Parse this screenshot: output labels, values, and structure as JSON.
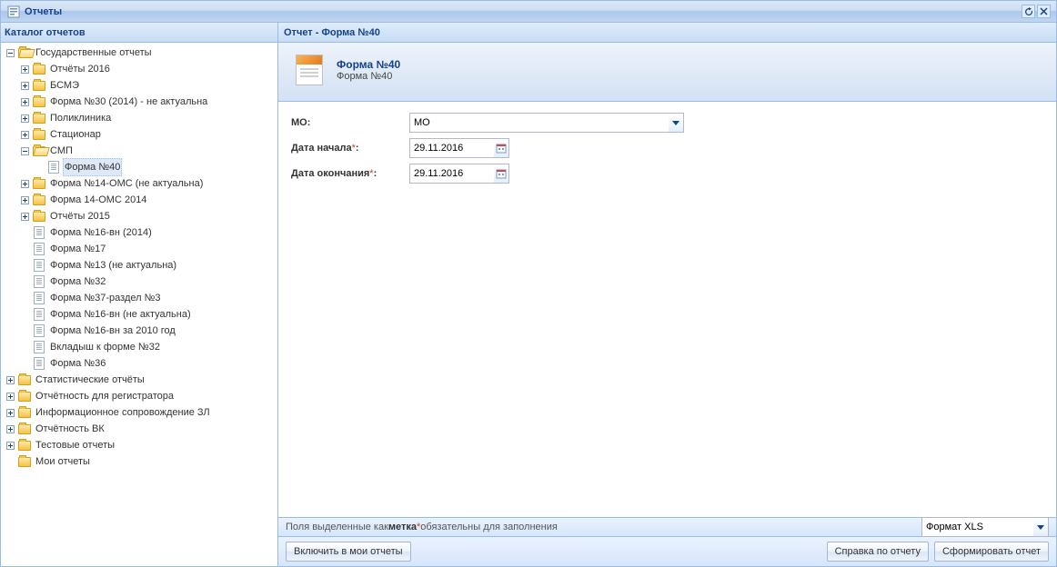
{
  "window": {
    "title": "Отчеты"
  },
  "catalog": {
    "title": "Каталог отчетов",
    "root": "Государственные отчеты",
    "n0": "Отчёты 2016",
    "n1": "БСМЭ",
    "n2": "Форма №30 (2014) - не актуальна",
    "n3": "Поликлиника",
    "n4": "Стационар",
    "n5": "СМП",
    "n5_0": "Форма №40",
    "n6": "Форма №14-ОМС (не актуальна)",
    "n7": "Форма 14-ОМС 2014",
    "n8": "Отчёты 2015",
    "d0": "Форма №16-вн (2014)",
    "d1": "Форма №17",
    "d2": "Форма №13 (не актуальна)",
    "d3": "Форма №32",
    "d4": "Форма №37-раздел №3",
    "d5": "Форма №16-вн (не актуальна)",
    "d6": "Форма №16-вн за 2010 год",
    "d7": "Вкладыш к форме №32",
    "d8": "Форма №36",
    "r1": "Статистические отчёты",
    "r2": "Отчётность для регистратора",
    "r3": "Информационное сопровождение ЗЛ",
    "r4": "Отчётность ВК",
    "r5": "Тестовые отчеты",
    "r6": "Мои отчеты"
  },
  "report": {
    "header": "Отчет - Форма №40",
    "title": "Форма №40",
    "subtitle": "Форма №40",
    "mo_label": "МО:",
    "mo_value": "МО",
    "date_start_label": "Дата начала",
    "date_start_value": "29.11.2016",
    "date_end_label": "Дата окончания",
    "date_end_value": "29.11.2016"
  },
  "note": {
    "prefix": "Поля выделенные как ",
    "metka": "метка",
    "suffix": " обязательны для заполнения"
  },
  "format": {
    "value": "Формат XLS"
  },
  "buttons": {
    "include": "Включить в мои отчеты",
    "help": "Справка по отчету",
    "generate": "Сформировать отчет"
  }
}
